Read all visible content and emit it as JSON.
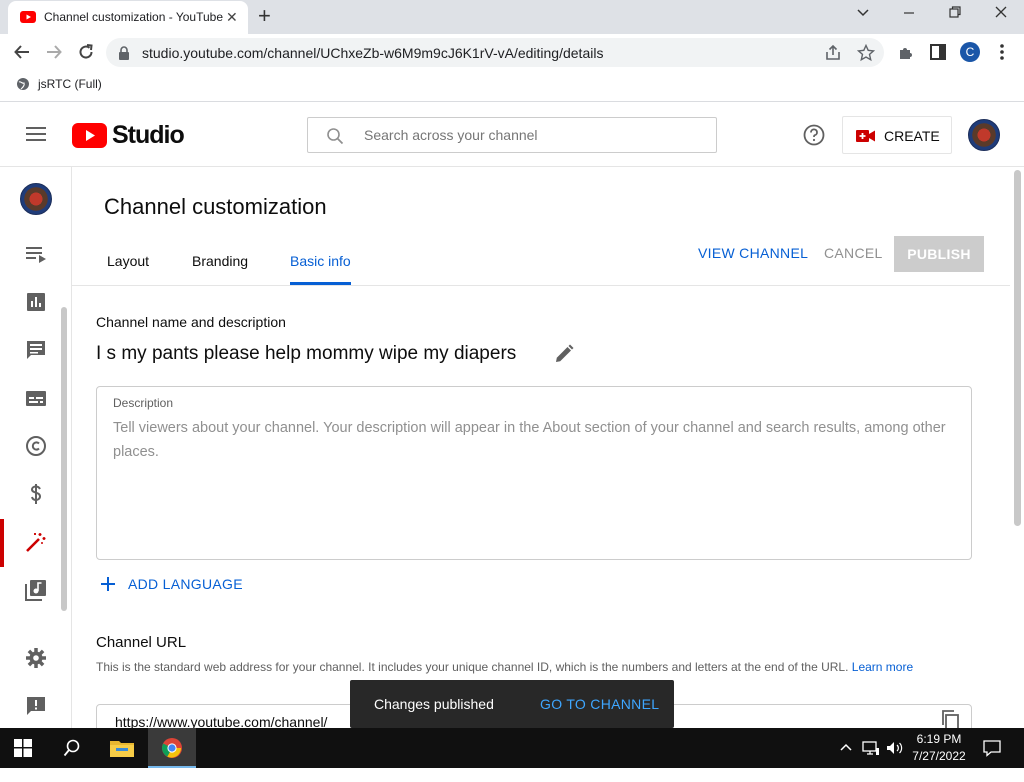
{
  "browser": {
    "tab_title": "Channel customization - YouTube Studio",
    "url": "studio.youtube.com/channel/UChxeZb-w6M9m9cJ6K1rV-vA/editing/details",
    "profile_initial": "C",
    "bookmark_label": "jsRTC (Full)"
  },
  "header": {
    "logo_text": "Studio",
    "search_placeholder": "Search across your channel",
    "create_label": "CREATE"
  },
  "page": {
    "title": "Channel customization",
    "tabs": [
      {
        "label": "Layout"
      },
      {
        "label": "Branding"
      },
      {
        "label": "Basic info"
      }
    ],
    "view_channel": "VIEW CHANNEL",
    "cancel": "CANCEL",
    "publish": "PUBLISH"
  },
  "basic_info": {
    "section_title": "Channel name and description",
    "channel_name": "I s my pants please help mommy wipe my diapers",
    "description_label": "Description",
    "description_placeholder": "Tell viewers about your channel. Your description will appear in the About section of your channel and search results, among other places.",
    "add_language": "ADD LANGUAGE",
    "url_title": "Channel URL",
    "url_description": "This is the standard web address for your channel. It includes your unique channel ID, which is the numbers and letters at the end of the URL.",
    "learn_more": "Learn more",
    "channel_url": "https://www.youtube.com/channel/"
  },
  "toast": {
    "message": "Changes published",
    "action": "GO TO CHANNEL"
  },
  "taskbar": {
    "time": "6:19 PM",
    "date": "7/27/2022"
  },
  "colors": {
    "accent_blue": "#065fd4",
    "brand_red": "#ff0000",
    "active_nav_red": "#cc0000"
  },
  "icons": {
    "nav": [
      "dashboard-avatar",
      "content-icon",
      "analytics-icon",
      "comments-icon",
      "subtitles-icon",
      "copyright-icon",
      "monetization-icon",
      "customization-icon",
      "audio-library-icon",
      "settings-icon",
      "feedback-icon"
    ]
  }
}
